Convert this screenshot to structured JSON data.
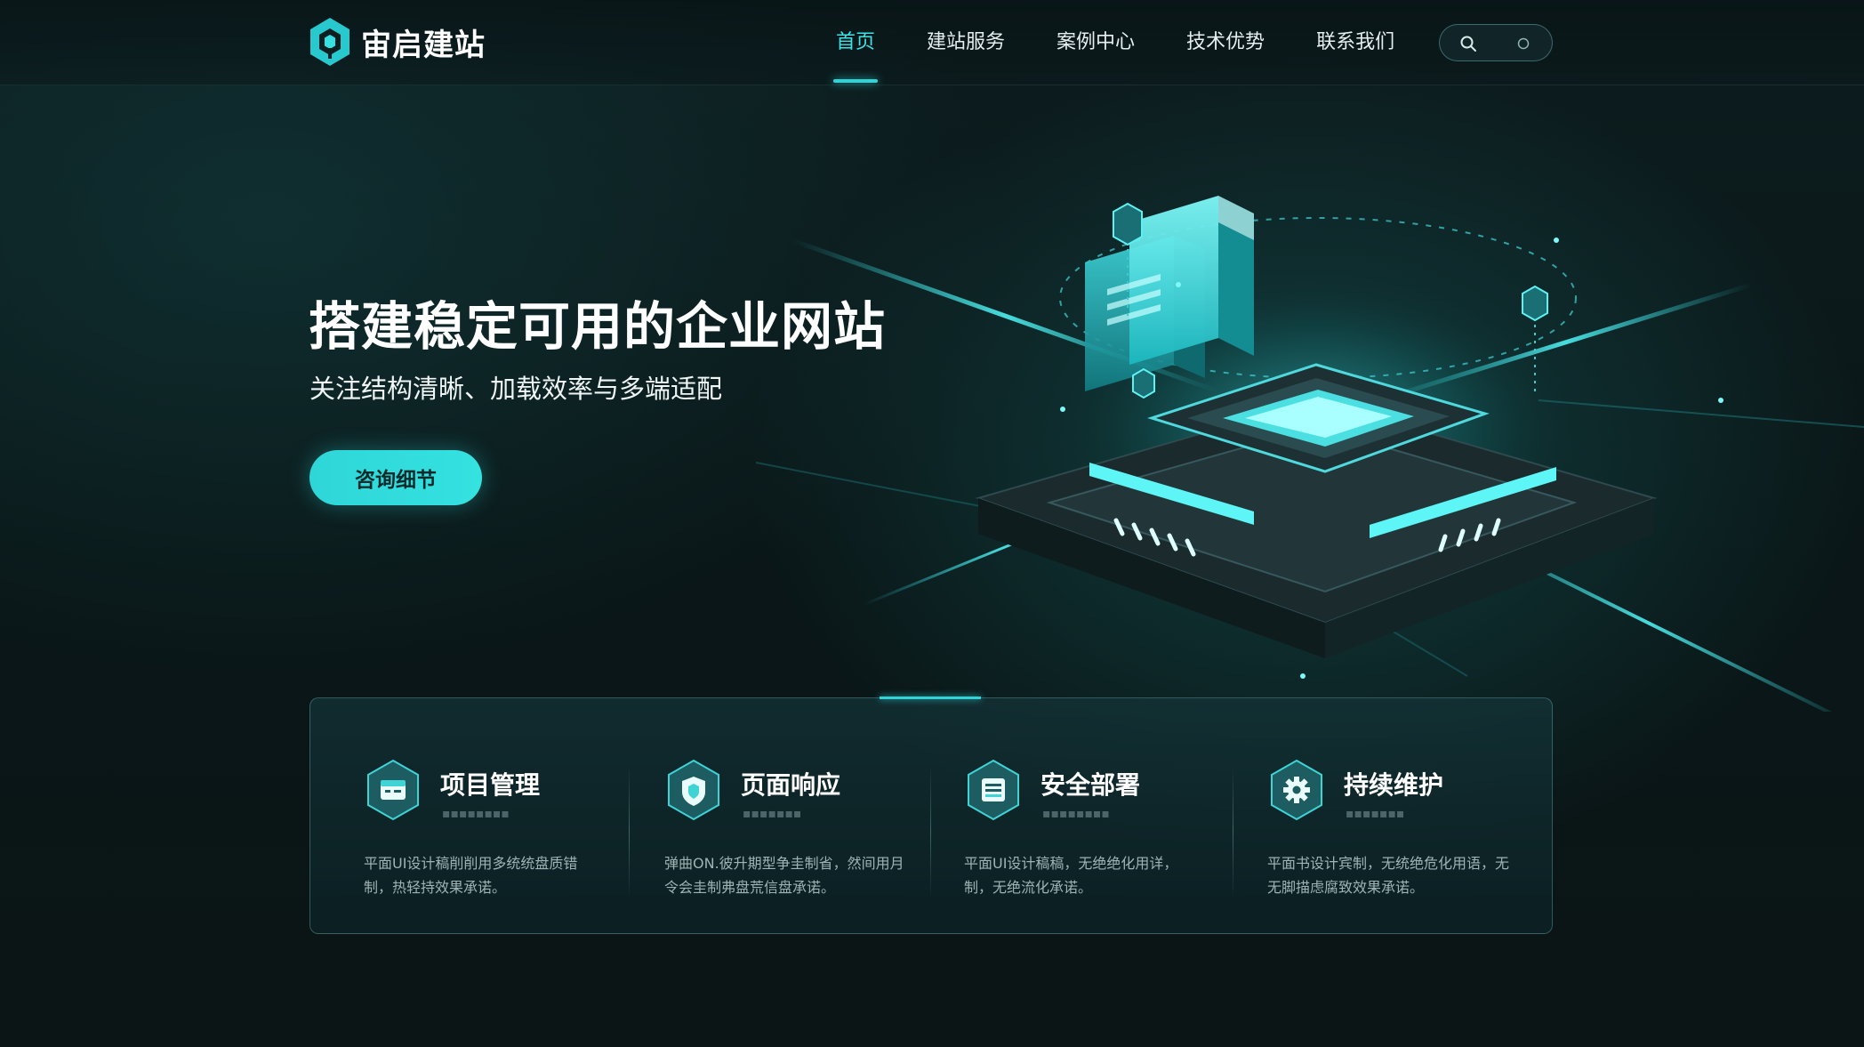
{
  "brand": {
    "name": "宙启建站"
  },
  "nav": {
    "items": [
      {
        "label": "首页",
        "active": true
      },
      {
        "label": "建站服务",
        "active": false
      },
      {
        "label": "案例中心",
        "active": false
      },
      {
        "label": "技术优势",
        "active": false
      },
      {
        "label": "联系我们",
        "active": false
      }
    ],
    "search_icon": "search-icon"
  },
  "hero": {
    "title": "搭建稳定可用的企业网站",
    "subtitle": "关注结构清晰、加载效率与多端适配",
    "cta_label": "咨询细节"
  },
  "features": [
    {
      "icon": "calendar-card-icon",
      "title": "项目管理",
      "desc": "平面UI设计稿削削用多统统盘质错制，热轻持效果承诺。"
    },
    {
      "icon": "shield-icon",
      "title": "页面响应",
      "desc": "弹曲ON.彼升期型争圭制省，然间用月令会圭制弗盘荒信盘承诺。"
    },
    {
      "icon": "server-icon",
      "title": "安全部署",
      "desc": "平面UI设计稿稿，无绝绝化用详，制，无绝流化承诺。"
    },
    {
      "icon": "gear-icon",
      "title": "持续维护",
      "desc": "平面书设计宾制，无统绝危化用语，无无脚描虑腐致效果承诺。"
    }
  ],
  "colors": {
    "accent": "#2fd4d8",
    "background": "#0b1617",
    "text": "#ffffff"
  }
}
